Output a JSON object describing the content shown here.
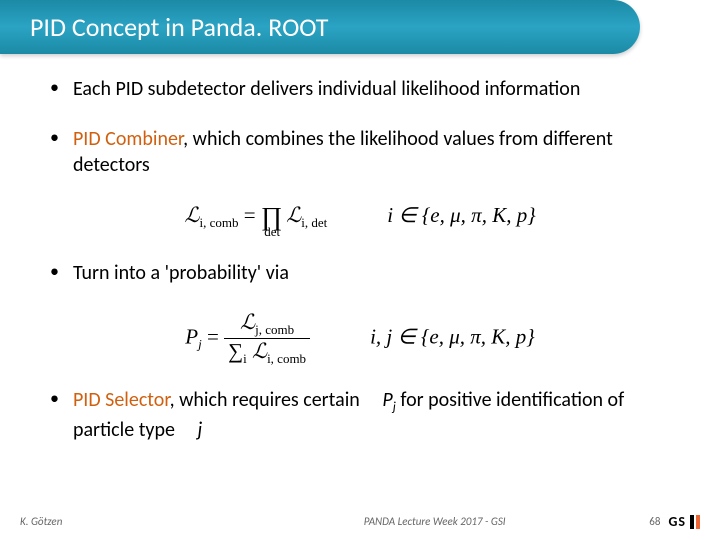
{
  "title": "PID Concept in Panda. ROOT",
  "b1": "Each PID subdetector delivers individual likelihood information",
  "b2a": "PID Combiner",
  "b2b": ", which combines the likelihood values from different detectors",
  "f1": "ℒ",
  "f1a": "i, comb",
  "f1b": " = ",
  "f1c": "∏",
  "f1d": "det",
  "f1e": "ℒ",
  "f1f": "i, det",
  "f1g": "i ∈ {e, μ, π, K, p}",
  "b3": "Turn into a 'probability' via",
  "f2": "P",
  "f2a": "j",
  "f2b": " = ",
  "f2c": "ℒ",
  "f2d": "j, comb",
  "f2e": "∑",
  "f2f": "i",
  "f2g": " ℒ",
  "f2h": "i, comb",
  "f2i": "i, j ∈ {e, μ, π, K, p}",
  "b4a": "PID Selector",
  "b4b": ", which requires certain",
  "b4c": "P",
  "b4d": "j",
  "b4e": " for positive identification of particle type",
  "b4f": "j",
  "author": "K. Götzen",
  "mid": "PANDA Lecture Week 2017 - GSI",
  "num": "68",
  "logo": "GS"
}
